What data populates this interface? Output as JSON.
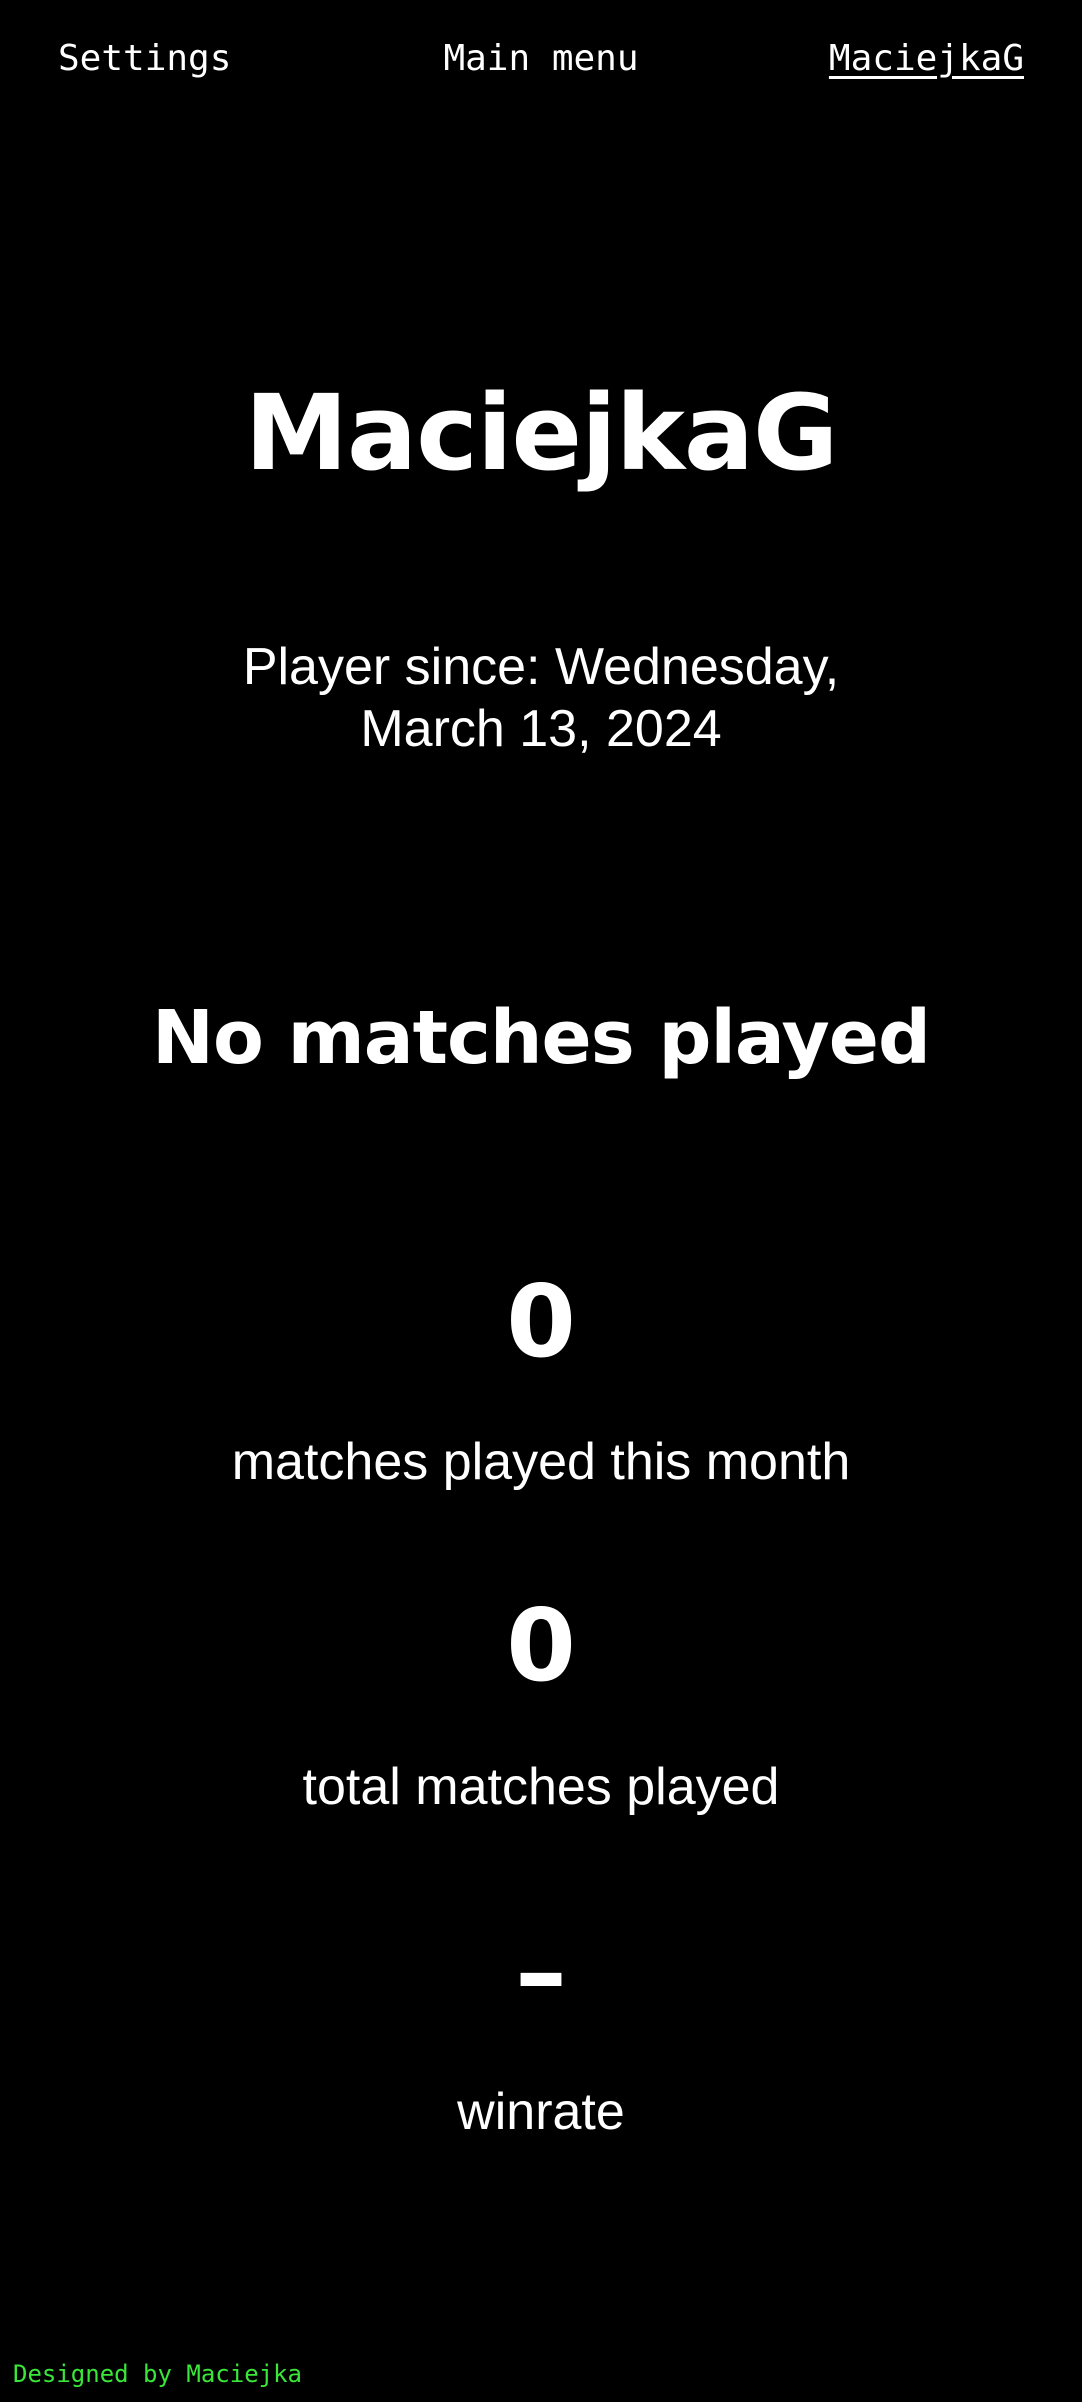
{
  "nav": {
    "settings_label": "Settings",
    "main_menu_label": "Main menu",
    "user_label": "MaciejkaG"
  },
  "profile": {
    "username": "MaciejkaG",
    "player_since": "Player since: Wednesday, March 13, 2024",
    "no_matches": "No matches played"
  },
  "stats": {
    "month_value": "0",
    "month_label": "matches played this month",
    "total_value": "0",
    "total_label": "total matches played",
    "winrate_value": "–",
    "winrate_label": "winrate"
  },
  "footer": {
    "credit": "Designed by Maciejka"
  },
  "colors": {
    "background": "#000000",
    "text": "#ffffff",
    "footer_accent": "#39e639"
  }
}
